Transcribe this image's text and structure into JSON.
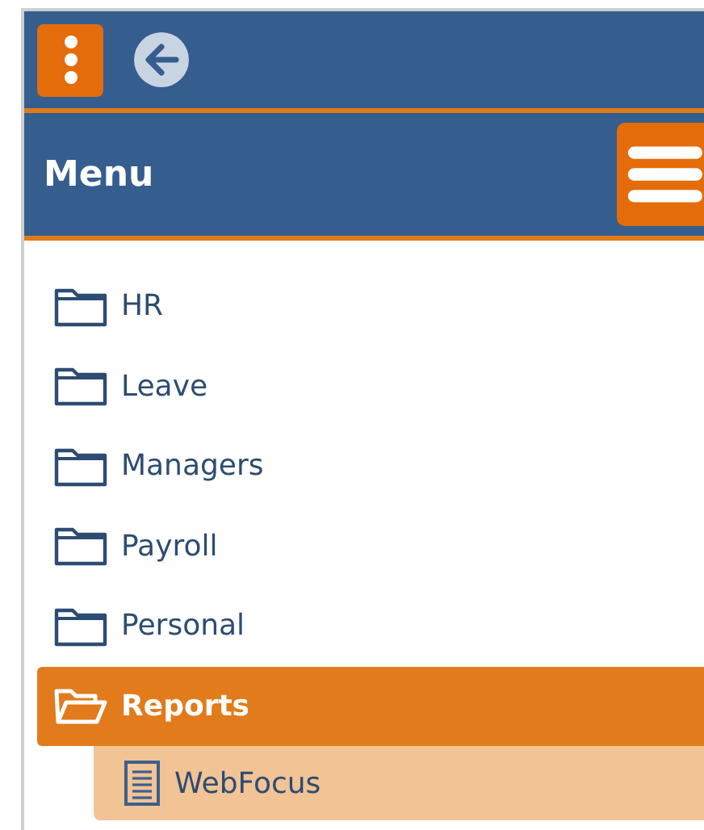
{
  "header": {
    "title": "Menu"
  },
  "tree": [
    {
      "label": "HR",
      "expanded": false,
      "selected": false
    },
    {
      "label": "Leave",
      "expanded": false,
      "selected": false
    },
    {
      "label": "Managers",
      "expanded": false,
      "selected": false
    },
    {
      "label": "Payroll",
      "expanded": false,
      "selected": false
    },
    {
      "label": "Personal",
      "expanded": false,
      "selected": false
    },
    {
      "label": "Reports",
      "expanded": true,
      "selected": true,
      "children": [
        {
          "label": "WebFocus",
          "selected": false
        }
      ]
    }
  ]
}
